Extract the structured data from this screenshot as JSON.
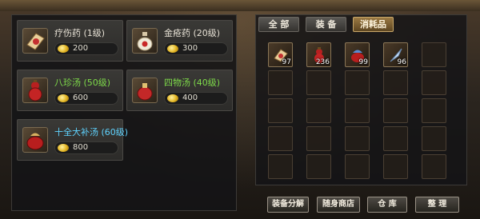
{
  "shop": {
    "items": [
      {
        "name": "疗伤药 (1级)",
        "price": "200",
        "icon": "scroll-medicine-icon",
        "tone": "normal"
      },
      {
        "name": "金疮药 (20级)",
        "price": "300",
        "icon": "potion-bottle-icon",
        "tone": "normal"
      },
      {
        "name": "八珍汤 (50级)",
        "price": "600",
        "icon": "red-gourd-icon",
        "tone": "green"
      },
      {
        "name": "四物汤 (40级)",
        "price": "400",
        "icon": "red-pouch-icon",
        "tone": "green"
      },
      {
        "name": "十全大补汤 (60级)",
        "price": "800",
        "icon": "red-bag-icon",
        "tone": "cyan"
      }
    ]
  },
  "inventory": {
    "tabs": [
      "全 部",
      "装 备",
      "消耗品"
    ],
    "active_tab": 2,
    "slots": [
      {
        "icon": "scroll-medicine-icon",
        "count": "97"
      },
      {
        "icon": "red-gourd-icon",
        "count": "236"
      },
      {
        "icon": "red-bag-icon",
        "count": "99"
      },
      {
        "icon": "feather-icon",
        "count": "96"
      }
    ]
  },
  "buttons": {
    "decompose": "装备分解",
    "portable_shop": "随身商店",
    "warehouse": "仓 库",
    "arrange": "整 理"
  },
  "colors": {
    "green_tier": "#7fdc4a",
    "cyan_tier": "#5fd3ff",
    "active_tab": "#9b7a44"
  }
}
